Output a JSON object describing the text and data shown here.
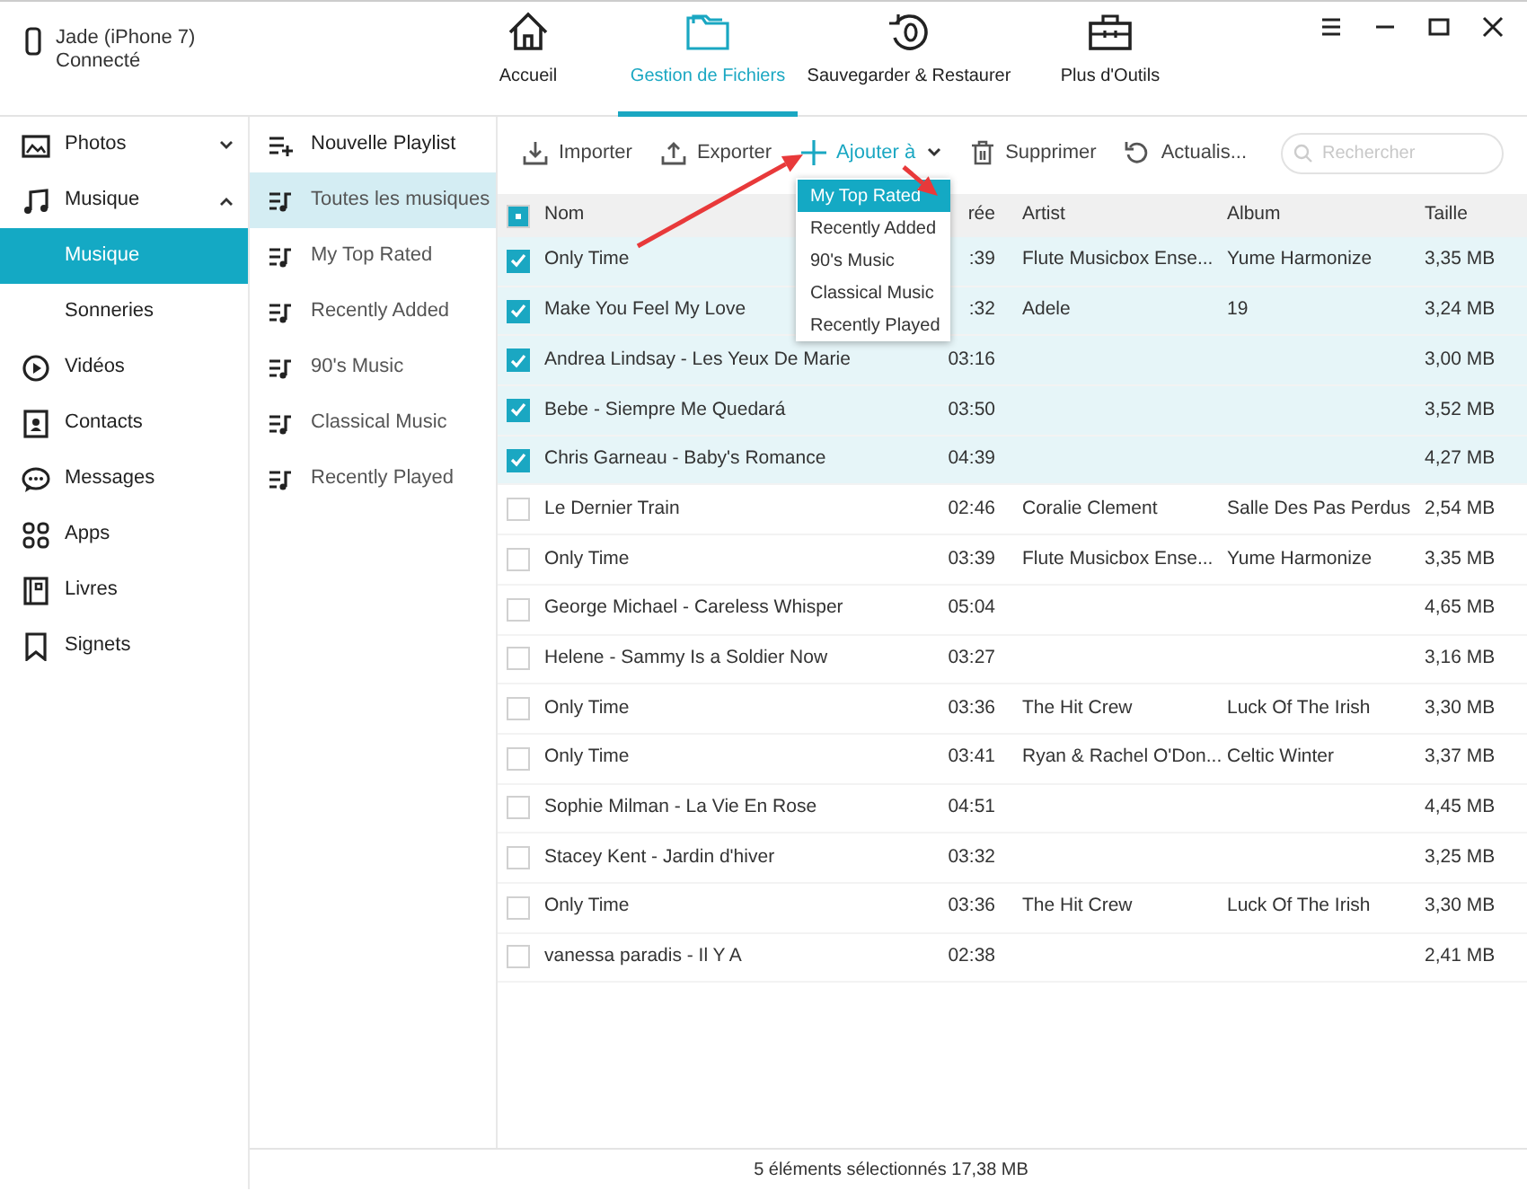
{
  "device": {
    "name": "Jade (iPhone 7)",
    "status": "Connecté"
  },
  "nav_tabs": [
    {
      "label": "Accueil",
      "selected": false
    },
    {
      "label": "Gestion de Fichiers",
      "selected": true
    },
    {
      "label": "Sauvegarder & Restaurer",
      "selected": false
    },
    {
      "label": "Plus d'Outils",
      "selected": false
    }
  ],
  "sidebar": {
    "items": [
      {
        "label": "Photos",
        "expanded": false
      },
      {
        "label": "Musique",
        "expanded": true,
        "children": [
          {
            "label": "Musique",
            "selected": true
          },
          {
            "label": "Sonneries",
            "selected": false
          }
        ]
      },
      {
        "label": "Vidéos"
      },
      {
        "label": "Contacts"
      },
      {
        "label": "Messages"
      },
      {
        "label": "Apps"
      },
      {
        "label": "Livres"
      },
      {
        "label": "Signets"
      }
    ]
  },
  "playlists": [
    {
      "kind": "action",
      "label": "Nouvelle Playlist",
      "selected": false
    },
    {
      "kind": "playlist",
      "label": "Toutes les musiques",
      "selected": true
    },
    {
      "kind": "playlist",
      "label": "My Top Rated",
      "selected": false
    },
    {
      "kind": "playlist",
      "label": "Recently Added",
      "selected": false
    },
    {
      "kind": "playlist",
      "label": "90's Music",
      "selected": false
    },
    {
      "kind": "playlist",
      "label": "Classical Music",
      "selected": false
    },
    {
      "kind": "playlist",
      "label": "Recently Played",
      "selected": false
    }
  ],
  "toolbar": [
    {
      "kind": "import",
      "label": "Importer",
      "expanded": false
    },
    {
      "kind": "export",
      "label": "Exporter",
      "expanded": false
    },
    {
      "kind": "add",
      "label": "Ajouter à",
      "expanded": true
    },
    {
      "kind": "delete",
      "label": "Supprimer",
      "expanded": false
    },
    {
      "kind": "refresh",
      "label": "Actualis...",
      "expanded": false
    }
  ],
  "search": {
    "placeholder": "Rechercher"
  },
  "add_menu": [
    {
      "label": "My Top Rated",
      "selected": true
    },
    {
      "label": "Recently Added",
      "selected": false
    },
    {
      "label": "90's Music",
      "selected": false
    },
    {
      "label": "Classical Music",
      "selected": false
    },
    {
      "label": "Recently Played",
      "selected": false
    }
  ],
  "table": {
    "select_all": {
      "indeterminate": true
    },
    "columns": [
      "Nom",
      "rée",
      "Artist",
      "Album",
      "Taille"
    ],
    "rows": [
      {
        "checked": true,
        "cells": [
          "Only Time",
          ":39",
          "Flute Musicbox Ense...",
          "Yume Harmonize",
          "3,35 MB"
        ]
      },
      {
        "checked": true,
        "cells": [
          "Make You Feel My Love",
          ":32",
          "Adele",
          "19",
          "3,24 MB"
        ]
      },
      {
        "checked": true,
        "cells": [
          "Andrea Lindsay - Les Yeux De Marie",
          "03:16",
          "",
          "",
          "3,00 MB"
        ]
      },
      {
        "checked": true,
        "cells": [
          "Bebe - Siempre Me Quedará",
          "03:50",
          "",
          "",
          "3,52 MB"
        ]
      },
      {
        "checked": true,
        "cells": [
          "Chris Garneau - Baby's Romance",
          "04:39",
          "",
          "",
          "4,27 MB"
        ]
      },
      {
        "checked": false,
        "cells": [
          "Le Dernier Train",
          "02:46",
          "Coralie Clement",
          "Salle Des Pas Perdus",
          "2,54 MB"
        ]
      },
      {
        "checked": false,
        "cells": [
          "Only Time",
          "03:39",
          "Flute Musicbox Ense...",
          "Yume Harmonize",
          "3,35 MB"
        ]
      },
      {
        "checked": false,
        "cells": [
          "George Michael - Careless Whisper",
          "05:04",
          "",
          "",
          "4,65 MB"
        ]
      },
      {
        "checked": false,
        "cells": [
          "Helene - Sammy Is a Soldier Now",
          "03:27",
          "",
          "",
          "3,16 MB"
        ]
      },
      {
        "checked": false,
        "cells": [
          "Only Time",
          "03:36",
          "The Hit Crew",
          "Luck Of The Irish",
          "3,30 MB"
        ]
      },
      {
        "checked": false,
        "cells": [
          "Only Time",
          "03:41",
          "Ryan & Rachel O'Don...",
          "Celtic Winter",
          "3,37 MB"
        ]
      },
      {
        "checked": false,
        "cells": [
          "Sophie Milman - La Vie En Rose",
          "04:51",
          "",
          "",
          "4,45 MB"
        ]
      },
      {
        "checked": false,
        "cells": [
          "Stacey Kent - Jardin d'hiver",
          "03:32",
          "",
          "",
          "3,25 MB"
        ]
      },
      {
        "checked": false,
        "cells": [
          "Only Time",
          "03:36",
          "The Hit Crew",
          "Luck Of The Irish",
          "3,30 MB"
        ]
      },
      {
        "checked": false,
        "cells": [
          "vanessa paradis - Il Y A",
          "02:38",
          "",
          "",
          "2,41 MB"
        ]
      }
    ]
  },
  "status_bar": "5 éléments sélectionnés 17,38 MB"
}
